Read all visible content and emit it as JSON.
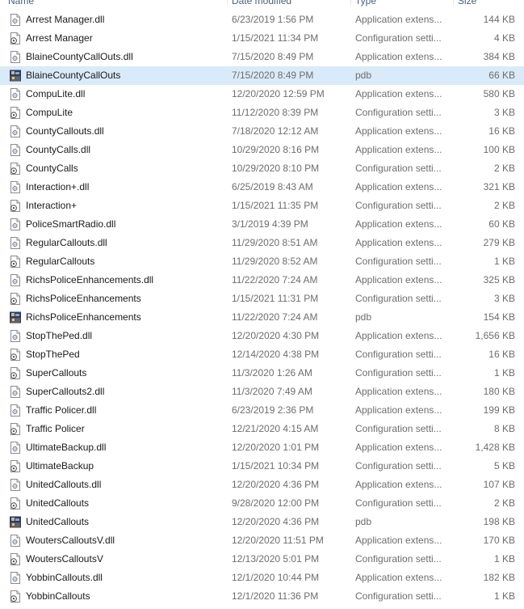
{
  "header": {
    "name": "Name",
    "date_modified": "Date modified",
    "type": "Type",
    "size": "Size"
  },
  "files": [
    {
      "name": "Arrest Manager.dll",
      "date": "6/23/2019 1:56 PM",
      "type": "Application extens...",
      "size": "144 KB",
      "icon": "dll-file-icon"
    },
    {
      "name": "Arrest Manager",
      "date": "1/15/2021 11:34 PM",
      "type": "Configuration setti...",
      "size": "4 KB",
      "icon": "config-file-icon"
    },
    {
      "name": "BlaineCountyCallOuts.dll",
      "date": "7/15/2020 8:49 PM",
      "type": "Application extens...",
      "size": "384 KB",
      "icon": "dll-file-icon"
    },
    {
      "name": "BlaineCountyCallOuts",
      "date": "7/15/2020 8:49 PM",
      "type": "pdb",
      "size": "66 KB",
      "icon": "pdb-file-icon",
      "selected": true
    },
    {
      "name": "CompuLite.dll",
      "date": "12/20/2020 12:59 PM",
      "type": "Application extens...",
      "size": "580 KB",
      "icon": "dll-file-icon"
    },
    {
      "name": "CompuLite",
      "date": "11/12/2020 8:39 PM",
      "type": "Configuration setti...",
      "size": "3 KB",
      "icon": "config-file-icon"
    },
    {
      "name": "CountyCallouts.dll",
      "date": "7/18/2020 12:12 AM",
      "type": "Application extens...",
      "size": "16 KB",
      "icon": "dll-file-icon"
    },
    {
      "name": "CountyCalls.dll",
      "date": "10/29/2020 8:16 PM",
      "type": "Application extens...",
      "size": "100 KB",
      "icon": "dll-file-icon"
    },
    {
      "name": "CountyCalls",
      "date": "10/29/2020 8:10 PM",
      "type": "Configuration setti...",
      "size": "2 KB",
      "icon": "config-file-icon"
    },
    {
      "name": "Interaction+.dll",
      "date": "6/25/2019 8:43 AM",
      "type": "Application extens...",
      "size": "321 KB",
      "icon": "dll-file-icon"
    },
    {
      "name": "Interaction+",
      "date": "1/15/2021 11:35 PM",
      "type": "Configuration setti...",
      "size": "2 KB",
      "icon": "config-file-icon"
    },
    {
      "name": "PoliceSmartRadio.dll",
      "date": "3/1/2019 4:39 PM",
      "type": "Application extens...",
      "size": "60 KB",
      "icon": "dll-file-icon"
    },
    {
      "name": "RegularCallouts.dll",
      "date": "11/29/2020 8:51 AM",
      "type": "Application extens...",
      "size": "279 KB",
      "icon": "dll-file-icon"
    },
    {
      "name": "RegularCallouts",
      "date": "11/29/2020 8:52 AM",
      "type": "Configuration setti...",
      "size": "1 KB",
      "icon": "config-file-icon"
    },
    {
      "name": "RichsPoliceEnhancements.dll",
      "date": "11/22/2020 7:24 AM",
      "type": "Application extens...",
      "size": "325 KB",
      "icon": "dll-file-icon"
    },
    {
      "name": "RichsPoliceEnhancements",
      "date": "1/15/2021 11:31 PM",
      "type": "Configuration setti...",
      "size": "3 KB",
      "icon": "config-file-icon"
    },
    {
      "name": "RichsPoliceEnhancements",
      "date": "11/22/2020 7:24 AM",
      "type": "pdb",
      "size": "154 KB",
      "icon": "pdb-file-icon"
    },
    {
      "name": "StopThePed.dll",
      "date": "12/20/2020 4:30 PM",
      "type": "Application extens...",
      "size": "1,656 KB",
      "icon": "dll-file-icon"
    },
    {
      "name": "StopThePed",
      "date": "12/14/2020 4:38 PM",
      "type": "Configuration setti...",
      "size": "16 KB",
      "icon": "config-file-icon"
    },
    {
      "name": "SuperCallouts",
      "date": "11/3/2020 1:26 AM",
      "type": "Configuration setti...",
      "size": "1 KB",
      "icon": "config-file-icon"
    },
    {
      "name": "SuperCallouts2.dll",
      "date": "11/3/2020 7:49 AM",
      "type": "Application extens...",
      "size": "180 KB",
      "icon": "dll-file-icon"
    },
    {
      "name": "Traffic Policer.dll",
      "date": "6/23/2019 2:36 PM",
      "type": "Application extens...",
      "size": "199 KB",
      "icon": "dll-file-icon"
    },
    {
      "name": "Traffic Policer",
      "date": "12/21/2020 4:15 AM",
      "type": "Configuration setti...",
      "size": "8 KB",
      "icon": "config-file-icon"
    },
    {
      "name": "UltimateBackup.dll",
      "date": "12/20/2020 1:01 PM",
      "type": "Application extens...",
      "size": "1,428 KB",
      "icon": "dll-file-icon"
    },
    {
      "name": "UltimateBackup",
      "date": "1/15/2021 10:34 PM",
      "type": "Configuration setti...",
      "size": "5 KB",
      "icon": "config-file-icon"
    },
    {
      "name": "UnitedCallouts.dll",
      "date": "12/20/2020 4:36 PM",
      "type": "Application extens...",
      "size": "107 KB",
      "icon": "dll-file-icon"
    },
    {
      "name": "UnitedCallouts",
      "date": "9/28/2020 12:00 PM",
      "type": "Configuration setti...",
      "size": "2 KB",
      "icon": "config-file-icon"
    },
    {
      "name": "UnitedCallouts",
      "date": "12/20/2020 4:36 PM",
      "type": "pdb",
      "size": "198 KB",
      "icon": "pdb-file-icon"
    },
    {
      "name": "WoutersCalloutsV.dll",
      "date": "12/20/2020 11:51 PM",
      "type": "Application extens...",
      "size": "170 KB",
      "icon": "dll-file-icon"
    },
    {
      "name": "WoutersCalloutsV",
      "date": "12/13/2020 5:01 PM",
      "type": "Configuration setti...",
      "size": "1 KB",
      "icon": "config-file-icon"
    },
    {
      "name": "YobbinCallouts.dll",
      "date": "12/1/2020 10:44 PM",
      "type": "Application extens...",
      "size": "182 KB",
      "icon": "dll-file-icon"
    },
    {
      "name": "YobbinCallouts",
      "date": "12/1/2020 11:36 PM",
      "type": "Configuration setti...",
      "size": "1 KB",
      "icon": "config-file-icon"
    }
  ]
}
